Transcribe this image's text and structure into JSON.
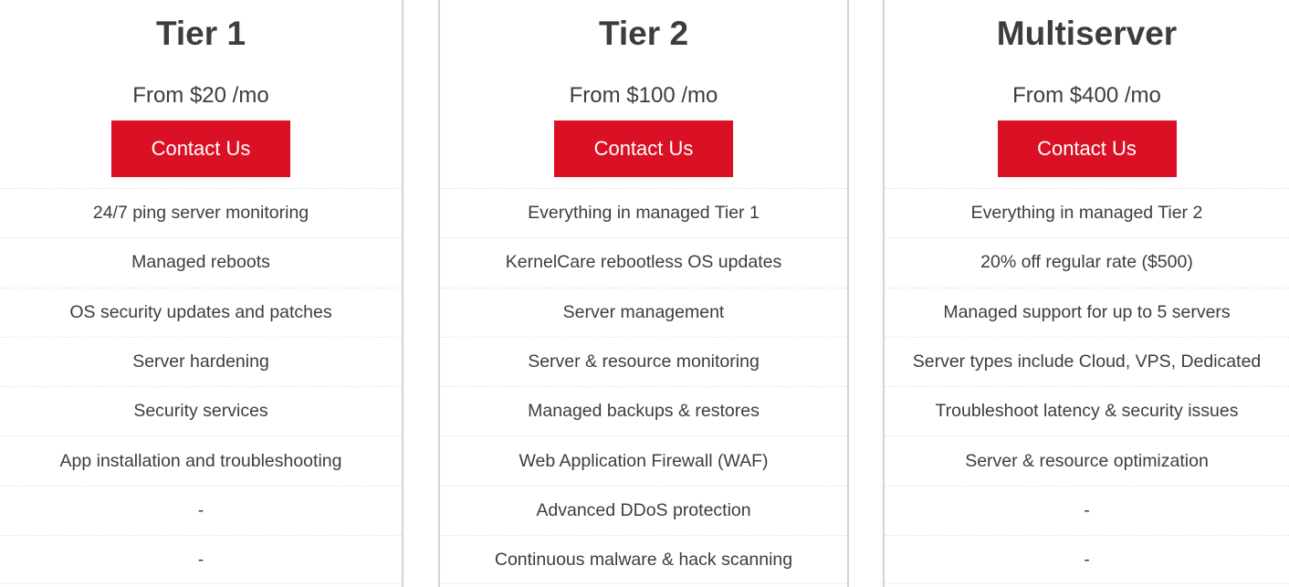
{
  "accent_color": "#da1025",
  "plans": [
    {
      "title": "Tier 1",
      "price": "From $20 /mo",
      "cta": "Contact Us",
      "features": [
        "24/7 ping server monitoring",
        "Managed reboots",
        "OS security updates and patches",
        "Server hardening",
        "Security services",
        "App installation and troubleshooting",
        "-",
        "-"
      ]
    },
    {
      "title": "Tier 2",
      "price": "From $100 /mo",
      "cta": "Contact Us",
      "features": [
        "Everything in managed Tier 1",
        "KernelCare rebootless OS updates",
        "Server management",
        "Server & resource monitoring",
        "Managed backups & restores",
        "Web Application Firewall (WAF)",
        "Advanced DDoS protection",
        "Continuous malware & hack scanning"
      ]
    },
    {
      "title": "Multiserver",
      "price": "From $400 /mo",
      "cta": "Contact Us",
      "features": [
        "Everything in managed Tier 2",
        "20% off regular rate ($500)",
        "Managed support for up to 5 servers",
        "Server types include Cloud, VPS, Dedicated",
        "Troubleshoot latency & security issues",
        "Server & resource optimization",
        "-",
        "-"
      ]
    }
  ]
}
